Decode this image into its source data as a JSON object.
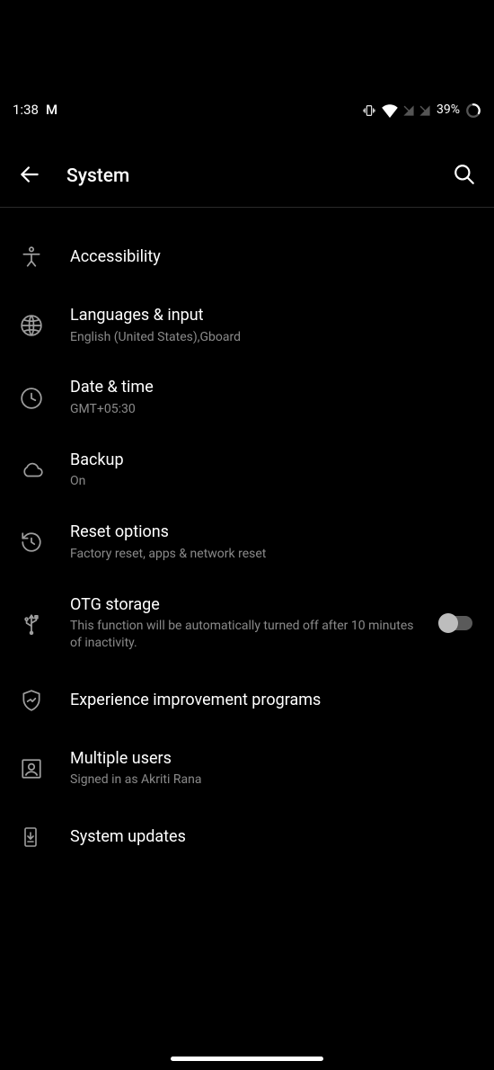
{
  "status": {
    "time": "1:38",
    "gmail_icon": "M",
    "battery_pct": "39%"
  },
  "header": {
    "title": "System"
  },
  "items": [
    {
      "icon": "accessibility",
      "title": "Accessibility",
      "subtitle": "",
      "toggle": false
    },
    {
      "icon": "globe",
      "title": "Languages & input",
      "subtitle": "English (United States),Gboard",
      "toggle": false
    },
    {
      "icon": "clock",
      "title": "Date & time",
      "subtitle": "GMT+05:30",
      "toggle": false
    },
    {
      "icon": "cloud",
      "title": "Backup",
      "subtitle": "On",
      "toggle": false
    },
    {
      "icon": "history",
      "title": "Reset options",
      "subtitle": "Factory reset, apps & network reset",
      "toggle": false
    },
    {
      "icon": "usb",
      "title": "OTG storage",
      "subtitle": "This function will be automatically turned off after 10 minutes of inactivity.",
      "toggle": true,
      "toggle_on": false
    },
    {
      "icon": "shield",
      "title": "Experience improvement programs",
      "subtitle": "",
      "toggle": false
    },
    {
      "icon": "users",
      "title": "Multiple users",
      "subtitle": "Signed in as Akriti Rana",
      "toggle": false
    },
    {
      "icon": "update",
      "title": "System updates",
      "subtitle": "",
      "toggle": false
    }
  ]
}
